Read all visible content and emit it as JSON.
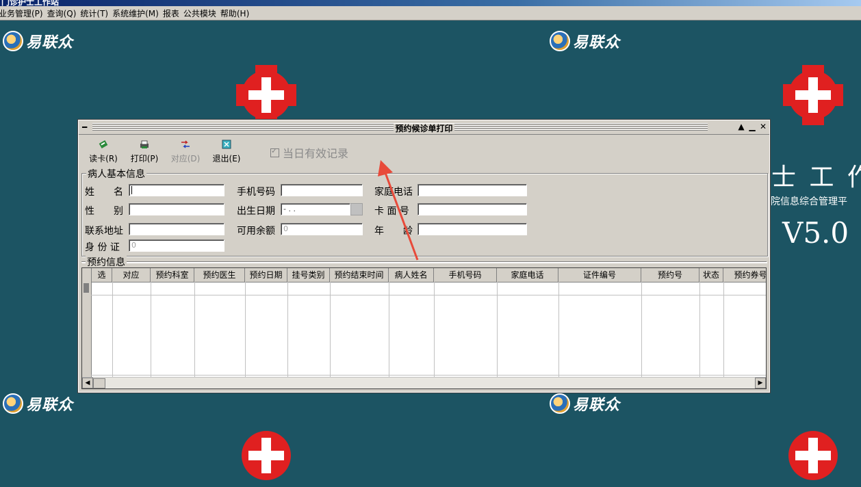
{
  "window": {
    "title": "门诊护士工作站"
  },
  "menu": [
    "业务管理(P)",
    "查询(Q)",
    "统计(T)",
    "系统维护(M)",
    "报表",
    "公共模块",
    "帮助(H)"
  ],
  "desktop": {
    "logo_text": "易联众",
    "app_title": "士 工 作",
    "app_subtitle": "院信息综合管理平",
    "version": "V5.0"
  },
  "dialog": {
    "title": "预约候诊单打印",
    "toolbar": {
      "read_card": "读卡(R)",
      "print": "打印(P)",
      "match": "对应(D)",
      "exit": "退出(E)"
    },
    "today_only": "当日有效记录",
    "patient_group": "病人基本信息",
    "fields": {
      "name_label": "姓　　名",
      "mobile_label": "手机号码",
      "home_phone_label": "家庭电话",
      "gender_label": "性　　别",
      "birth_label": "出生日期",
      "birth_value": "-  .  .",
      "card_label": "卡 面 号",
      "address_label": "联系地址",
      "balance_label": "可用余额",
      "balance_value": "0",
      "age_label": "年　　龄",
      "id_label": "身 份 证",
      "id_value": "0"
    },
    "appt_group": "预约信息",
    "grid_columns": [
      "选",
      "对应",
      "预约科室",
      "预约医生",
      "预约日期",
      "挂号类别",
      "预约结束时间",
      "病人姓名",
      "手机号码",
      "家庭电话",
      "证件编号",
      "预约号",
      "状态",
      "预约券号"
    ]
  },
  "colors": {
    "desktop_bg": "#1c5463",
    "dialog_bg": "#d4d0c8",
    "arrow": "#e84a3a"
  }
}
